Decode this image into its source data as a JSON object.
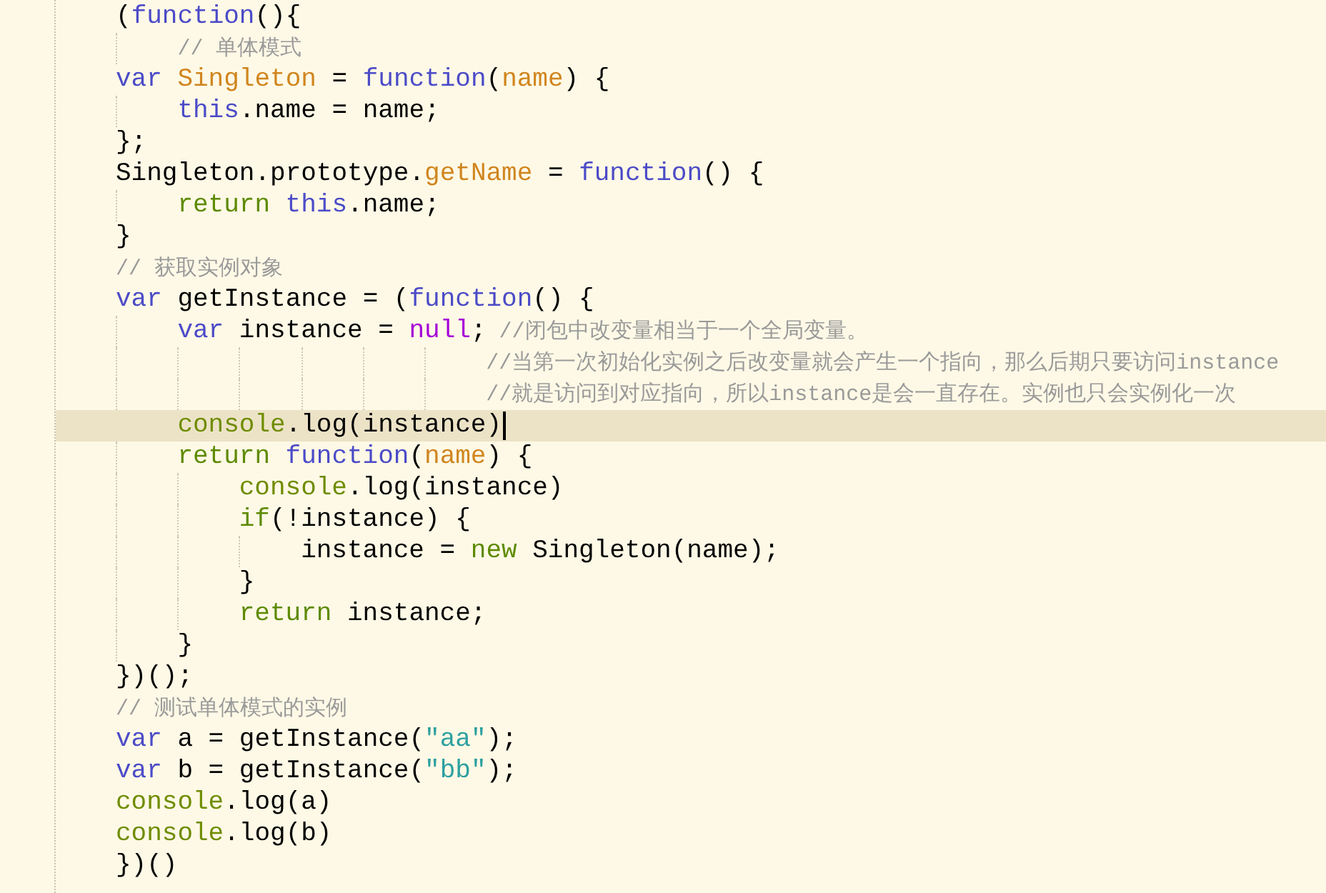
{
  "editor": {
    "lines": [
      {
        "active": false,
        "tokens": [
          {
            "kind": "plain",
            "text": "("
          },
          {
            "kind": "keyword",
            "text": "function"
          },
          {
            "kind": "plain",
            "text": "(){"
          }
        ]
      },
      {
        "active": false,
        "tokens": [
          {
            "kind": "comment",
            "text": "    // 单体模式"
          }
        ]
      },
      {
        "active": false,
        "tokens": [
          {
            "kind": "keyword",
            "text": "var"
          },
          {
            "kind": "name",
            "text": " Singleton"
          },
          {
            "kind": "plain",
            "text": " = "
          },
          {
            "kind": "keyword",
            "text": "function"
          },
          {
            "kind": "plain",
            "text": "("
          },
          {
            "kind": "name",
            "text": "name"
          },
          {
            "kind": "plain",
            "text": ") {"
          }
        ]
      },
      {
        "active": false,
        "tokens": [
          {
            "kind": "keyword",
            "text": "    this"
          },
          {
            "kind": "plain",
            "text": ".name = name;"
          }
        ]
      },
      {
        "active": false,
        "tokens": [
          {
            "kind": "plain",
            "text": "};"
          }
        ]
      },
      {
        "active": false,
        "tokens": [
          {
            "kind": "plain",
            "text": "Singleton.prototype."
          },
          {
            "kind": "name",
            "text": "getName"
          },
          {
            "kind": "plain",
            "text": " = "
          },
          {
            "kind": "keyword",
            "text": "function"
          },
          {
            "kind": "plain",
            "text": "() {"
          }
        ]
      },
      {
        "active": false,
        "tokens": [
          {
            "kind": "control",
            "text": "    return"
          },
          {
            "kind": "keyword",
            "text": " this"
          },
          {
            "kind": "plain",
            "text": ".name;"
          }
        ]
      },
      {
        "active": false,
        "tokens": [
          {
            "kind": "plain",
            "text": "}"
          }
        ]
      },
      {
        "active": false,
        "tokens": [
          {
            "kind": "comment",
            "text": "// 获取实例对象"
          }
        ]
      },
      {
        "active": false,
        "tokens": [
          {
            "kind": "keyword",
            "text": "var"
          },
          {
            "kind": "plain",
            "text": " getInstance = ("
          },
          {
            "kind": "keyword",
            "text": "function"
          },
          {
            "kind": "plain",
            "text": "() {"
          }
        ]
      },
      {
        "active": false,
        "tokens": [
          {
            "kind": "keyword",
            "text": "    var"
          },
          {
            "kind": "plain",
            "text": " instance = "
          },
          {
            "kind": "null",
            "text": "null"
          },
          {
            "kind": "plain",
            "text": ";"
          },
          {
            "kind": "comment",
            "text": " //闭包中改变量相当于一个全局变量。"
          }
        ]
      },
      {
        "active": false,
        "tokens": [
          {
            "kind": "comment",
            "text": "                        //当第一次初始化实例之后改变量就会产生一个指向，那么后期只要访问instance"
          }
        ]
      },
      {
        "active": false,
        "tokens": [
          {
            "kind": "comment",
            "text": "                        //就是访问到对应指向，所以instance是会一直存在。实例也只会实例化一次"
          }
        ]
      },
      {
        "active": true,
        "tokens": [
          {
            "kind": "builtin",
            "text": "    console"
          },
          {
            "kind": "plain",
            "text": ".log(instance)"
          }
        ]
      },
      {
        "active": false,
        "tokens": [
          {
            "kind": "control",
            "text": "    return"
          },
          {
            "kind": "keyword",
            "text": " function"
          },
          {
            "kind": "plain",
            "text": "("
          },
          {
            "kind": "name",
            "text": "name"
          },
          {
            "kind": "plain",
            "text": ") {"
          }
        ]
      },
      {
        "active": false,
        "tokens": [
          {
            "kind": "builtin",
            "text": "        console"
          },
          {
            "kind": "plain",
            "text": ".log(instance)"
          }
        ]
      },
      {
        "active": false,
        "tokens": [
          {
            "kind": "control",
            "text": "        if"
          },
          {
            "kind": "plain",
            "text": "(!instance) {"
          }
        ]
      },
      {
        "active": false,
        "tokens": [
          {
            "kind": "plain",
            "text": "            instance = "
          },
          {
            "kind": "control",
            "text": "new"
          },
          {
            "kind": "plain",
            "text": " Singleton(name);"
          }
        ]
      },
      {
        "active": false,
        "tokens": [
          {
            "kind": "plain",
            "text": "        }"
          }
        ]
      },
      {
        "active": false,
        "tokens": [
          {
            "kind": "control",
            "text": "        return"
          },
          {
            "kind": "plain",
            "text": " instance;"
          }
        ]
      },
      {
        "active": false,
        "tokens": [
          {
            "kind": "plain",
            "text": "    }"
          }
        ]
      },
      {
        "active": false,
        "tokens": [
          {
            "kind": "plain",
            "text": "})();"
          }
        ]
      },
      {
        "active": false,
        "tokens": [
          {
            "kind": "comment",
            "text": "// 测试单体模式的实例"
          }
        ]
      },
      {
        "active": false,
        "tokens": [
          {
            "kind": "keyword",
            "text": "var"
          },
          {
            "kind": "plain",
            "text": " a = getInstance("
          },
          {
            "kind": "string",
            "text": "\"aa\""
          },
          {
            "kind": "plain",
            "text": ");"
          }
        ]
      },
      {
        "active": false,
        "tokens": [
          {
            "kind": "keyword",
            "text": "var"
          },
          {
            "kind": "plain",
            "text": " b = getInstance("
          },
          {
            "kind": "string",
            "text": "\"bb\""
          },
          {
            "kind": "plain",
            "text": ");"
          }
        ]
      },
      {
        "active": false,
        "tokens": [
          {
            "kind": "builtin",
            "text": "console"
          },
          {
            "kind": "plain",
            "text": ".log(a)"
          }
        ]
      },
      {
        "active": false,
        "tokens": [
          {
            "kind": "builtin",
            "text": "console"
          },
          {
            "kind": "plain",
            "text": ".log(b)"
          }
        ]
      },
      {
        "active": false,
        "tokens": [
          {
            "kind": "plain",
            "text": "})()"
          }
        ]
      }
    ]
  }
}
